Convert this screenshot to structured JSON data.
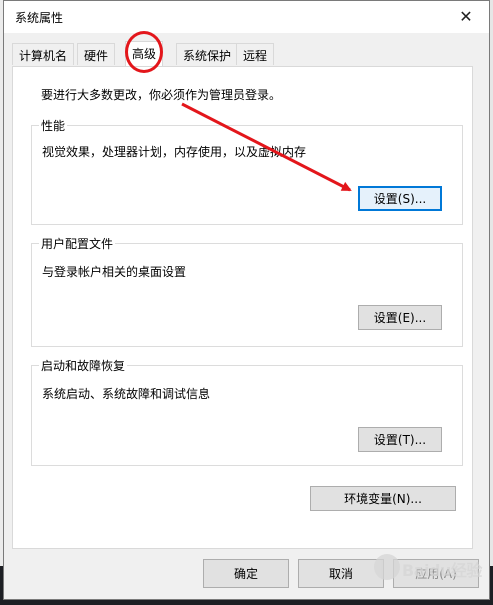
{
  "window": {
    "title": "系统属性",
    "close_glyph": "✕"
  },
  "tabs": [
    {
      "label": "计算机名",
      "active": false
    },
    {
      "label": "硬件",
      "active": false
    },
    {
      "label": "高级",
      "active": true
    },
    {
      "label": "系统保护",
      "active": false
    },
    {
      "label": "远程",
      "active": false
    }
  ],
  "panel": {
    "notice": "要进行大多数更改，你必须作为管理员登录。",
    "performance": {
      "label": "性能",
      "description": "视觉效果，处理器计划，内存使用，以及虚拟内存",
      "button": "设置(S)..."
    },
    "user_profiles": {
      "label": "用户配置文件",
      "description": "与登录帐户相关的桌面设置",
      "button": "设置(E)..."
    },
    "startup_recovery": {
      "label": "启动和故障恢复",
      "description": "系统启动、系统故障和调试信息",
      "button": "设置(T)..."
    },
    "env_button": "环境变量(N)..."
  },
  "footer": {
    "ok": "确定",
    "cancel": "取消",
    "apply": "应用(A)"
  },
  "annotation": {
    "color": "#e3161b"
  },
  "watermark": {
    "text": "Baidu经验"
  }
}
